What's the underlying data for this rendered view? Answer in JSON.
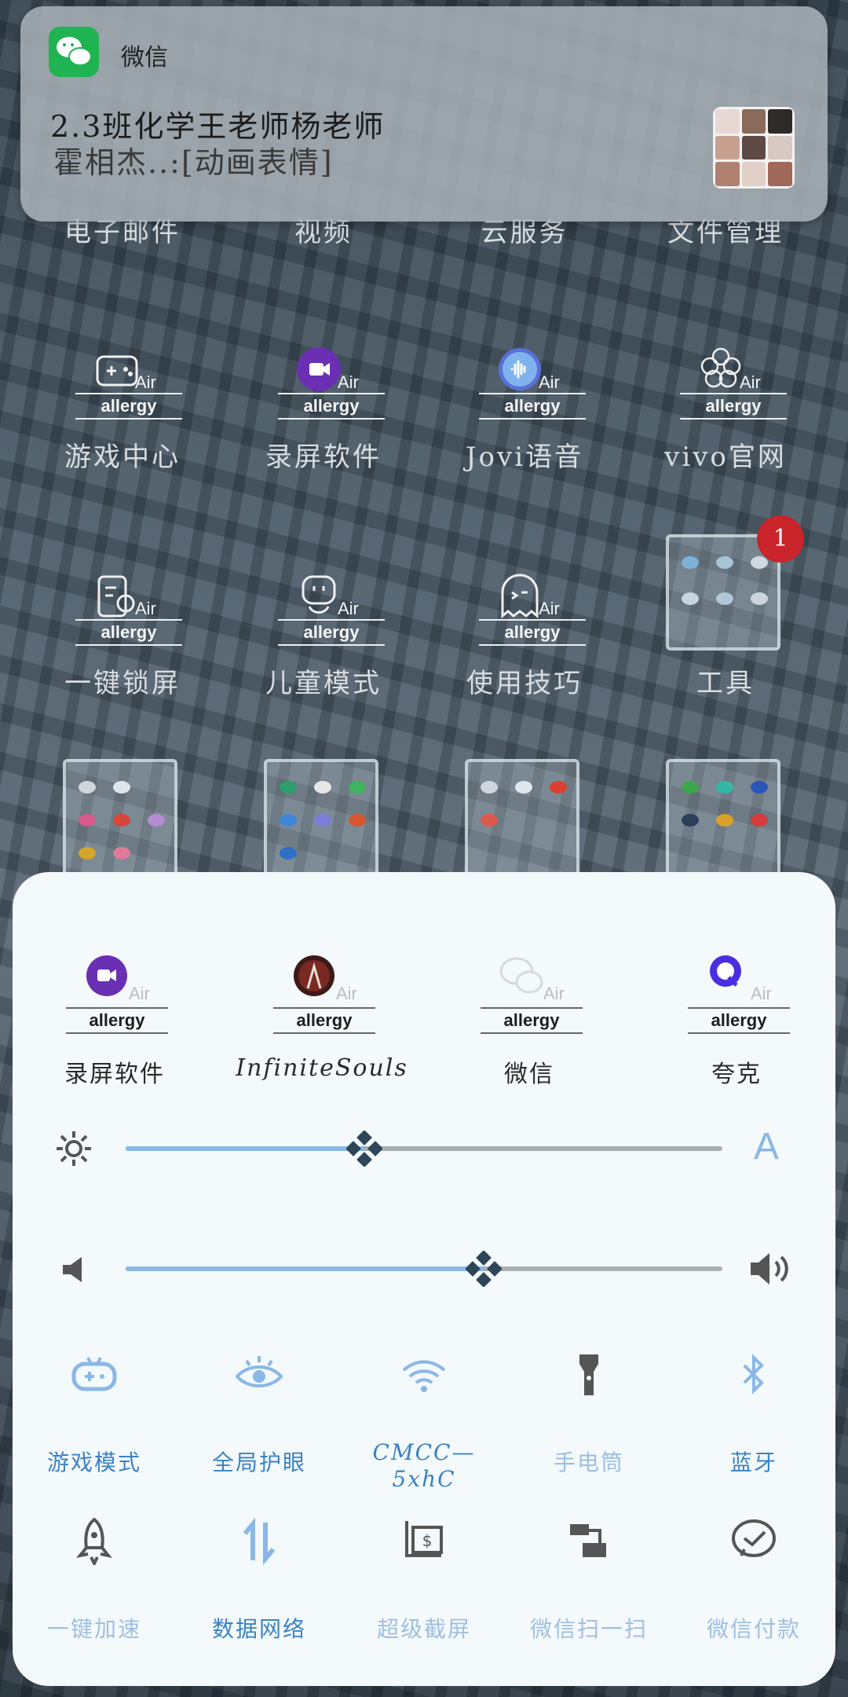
{
  "notification": {
    "app_name": "微信",
    "title": "2.3班化学王老师杨老师",
    "text": "霍相杰..:[动画表情]"
  },
  "home": {
    "top_partial_labels": [
      "电子邮件",
      "视频",
      "云服务",
      "文件管理"
    ],
    "watermark_brand": "Air",
    "watermark_text": "allergy",
    "row1": [
      {
        "label": "游戏中心",
        "icon": "gamepad-icon"
      },
      {
        "label": "录屏软件",
        "icon": "screen-record-icon"
      },
      {
        "label": "Jovi语音",
        "icon": "voice-icon"
      },
      {
        "label": "vivo官网",
        "icon": "flower-icon"
      }
    ],
    "row2": [
      {
        "label": "一键锁屏",
        "icon": "lock-screen-icon"
      },
      {
        "label": "儿童模式",
        "icon": "kids-mode-icon"
      },
      {
        "label": "使用技巧",
        "icon": "tips-icon"
      },
      {
        "label": "工具",
        "icon": "folder-icon"
      }
    ],
    "folder_badge": "1"
  },
  "panel": {
    "recent_apps": [
      {
        "label": "录屏软件",
        "icon": "screen-record-icon"
      },
      {
        "label": "InfiniteSouls",
        "icon": "infinitesouls-icon"
      },
      {
        "label": "微信",
        "icon": "wechat-icon"
      },
      {
        "label": "夸克",
        "icon": "quark-icon"
      }
    ],
    "brightness": {
      "level": 0.4,
      "auto_label": "A"
    },
    "volume": {
      "level": 0.6
    },
    "toggles_row1": [
      {
        "label": "游戏模式",
        "icon": "game-mode-icon",
        "active": true
      },
      {
        "label": "全局护眼",
        "icon": "eye-care-icon",
        "active": true
      },
      {
        "label": "CMCC—5xhC",
        "icon": "wifi-icon",
        "active": true
      },
      {
        "label": "手电筒",
        "icon": "flashlight-icon",
        "active": false
      },
      {
        "label": "蓝牙",
        "icon": "bluetooth-icon",
        "active": true
      }
    ],
    "toggles_row2": [
      {
        "label": "一键加速",
        "icon": "rocket-icon",
        "active": false
      },
      {
        "label": "数据网络",
        "icon": "data-network-icon",
        "active": true
      },
      {
        "label": "超级截屏",
        "icon": "screenshot-icon",
        "active": false
      },
      {
        "label": "微信扫一扫",
        "icon": "wechat-scan-icon",
        "active": false
      },
      {
        "label": "微信付款",
        "icon": "wechat-pay-icon",
        "active": false
      }
    ],
    "colors": {
      "active": "#3b82c4",
      "inactive": "#9fbfe0",
      "slider_fill": "#8ab7e6",
      "thumb": "#2d4659"
    }
  }
}
